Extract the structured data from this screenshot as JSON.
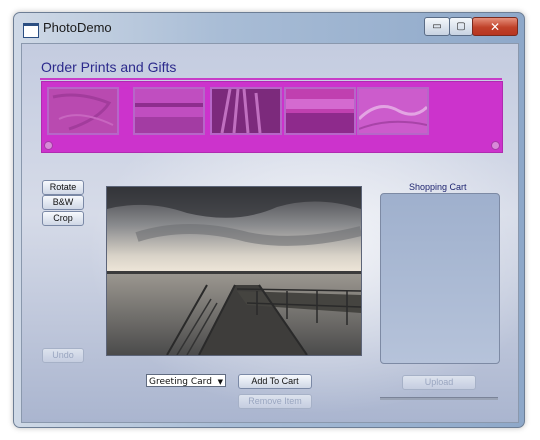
{
  "window": {
    "title": "PhotoDemo",
    "controls": {
      "minimize": "▭",
      "maximize": "▢",
      "close": "✕"
    }
  },
  "header": {
    "title": "Order Prints and Gifts"
  },
  "gallery": {
    "thumbnails": [
      {
        "name": "thumbnail-1"
      },
      {
        "name": "thumbnail-2"
      },
      {
        "name": "thumbnail-3"
      },
      {
        "name": "thumbnail-4"
      },
      {
        "name": "thumbnail-5"
      }
    ],
    "background_color": "#cc33cc"
  },
  "edit_buttons": {
    "rotate": "Rotate",
    "bw": "B&W",
    "crop": "Crop",
    "undo": "Undo"
  },
  "order": {
    "product_selected": "Greeting Card",
    "add_to_cart": "Add To Cart",
    "remove_item": "Remove Item"
  },
  "cart": {
    "label": "Shopping Cart",
    "upload": "Upload"
  }
}
